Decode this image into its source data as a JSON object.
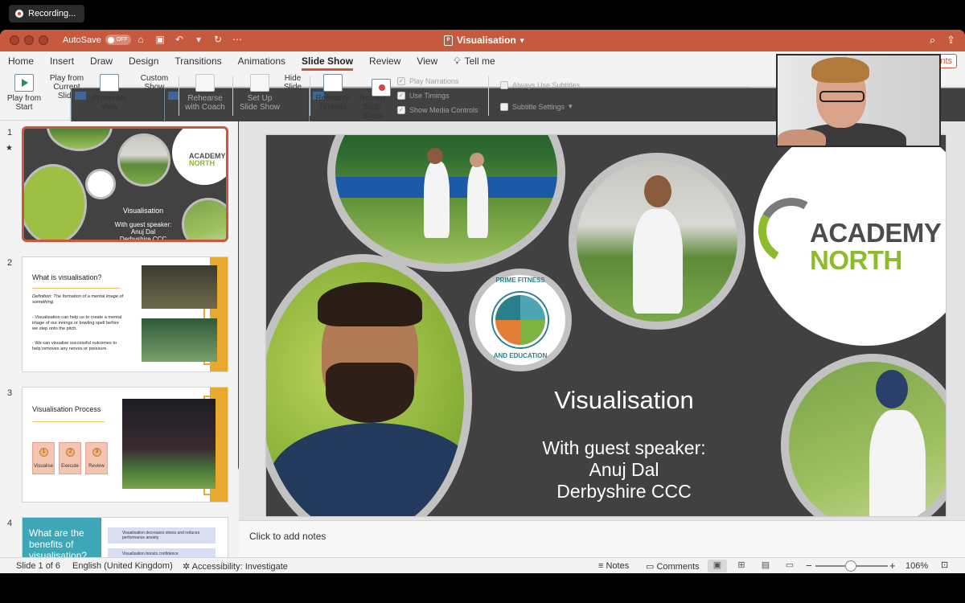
{
  "recording": {
    "label": "Recording..."
  },
  "titlebar": {
    "autosave_label": "AutoSave",
    "autosave_state": "OFF",
    "doc_title": "Visualisation",
    "doc_icon": "P"
  },
  "tabs": [
    "Home",
    "Insert",
    "Draw",
    "Design",
    "Transitions",
    "Animations",
    "Slide Show",
    "Review",
    "View"
  ],
  "active_tab": "Slide Show",
  "tell_me": "Tell me",
  "comments_label": "ents",
  "ribbon": {
    "play_from_start": [
      "Play from",
      "Start"
    ],
    "play_from_current": [
      "Play from",
      "Current Slide"
    ],
    "presenter_view": [
      "Presenter",
      "View"
    ],
    "custom_show": [
      "Custom",
      "Show"
    ],
    "rehearse_with_coach": [
      "Rehearse",
      "with Coach"
    ],
    "set_up_slide_show": [
      "Set Up",
      "Slide Show"
    ],
    "hide_slide": [
      "Hide",
      "Slide"
    ],
    "rehearse_timings": [
      "Rehearse",
      "Timings"
    ],
    "record_slide_show": [
      "Record",
      "Slide Show"
    ],
    "play_narrations": "Play Narrations",
    "use_timings": "Use Timings",
    "show_media_controls": "Show Media Controls",
    "always_use_subtitles": "Always Use Subtitles",
    "subtitle_settings": "Subtitle Settings"
  },
  "thumbnails": {
    "numbers": [
      "1",
      "2",
      "3",
      "4"
    ],
    "slide1": {
      "title": "Visualisation",
      "line1": "With guest speaker:",
      "line2": "Anuj Dal",
      "line3": "Derbyshire CCC",
      "logo1": "ACADEMY",
      "logo2": "NORTH"
    },
    "slide2": {
      "title": "What is visualisation?",
      "definition": "Definition: The formation of a mental image of something.",
      "bullet1": "- Visualisation can help us to create a mental image of our innings or bowling spell before we step onto the pitch.",
      "bullet2": "- We can visualise successful outcomes to help removes any nerves or pressure."
    },
    "slide3": {
      "title": "Visualisation Process",
      "steps": [
        "Visualise",
        "Execute",
        "Review"
      ],
      "nums": [
        "1",
        "2",
        "3"
      ]
    },
    "slide4": {
      "title": "What are the benefits of visualisation?",
      "item1": "Visualisation decreases stress and reduces performance anxiety",
      "item2": "Visualisation boosts confidence"
    }
  },
  "slide": {
    "logo_top": "ACADEMY",
    "logo_bottom": "NORTH",
    "badge_top": "PRIME FITNESS",
    "badge_bottom": "AND EDUCATION",
    "title": "Visualisation",
    "subtitle1": "With guest speaker:",
    "subtitle2": "Anuj Dal",
    "subtitle3": "Derbyshire CCC"
  },
  "notes_placeholder": "Click to add notes",
  "status": {
    "slide_counter": "Slide 1 of 6",
    "language": "English (United Kingdom)",
    "accessibility": "Accessibility: Investigate",
    "notes": "Notes",
    "comments": "Comments",
    "zoom": "106%"
  },
  "colors": {
    "accent": "#c55a3e",
    "slide_bg": "#414141",
    "brand_green": "#8dbb2b"
  }
}
